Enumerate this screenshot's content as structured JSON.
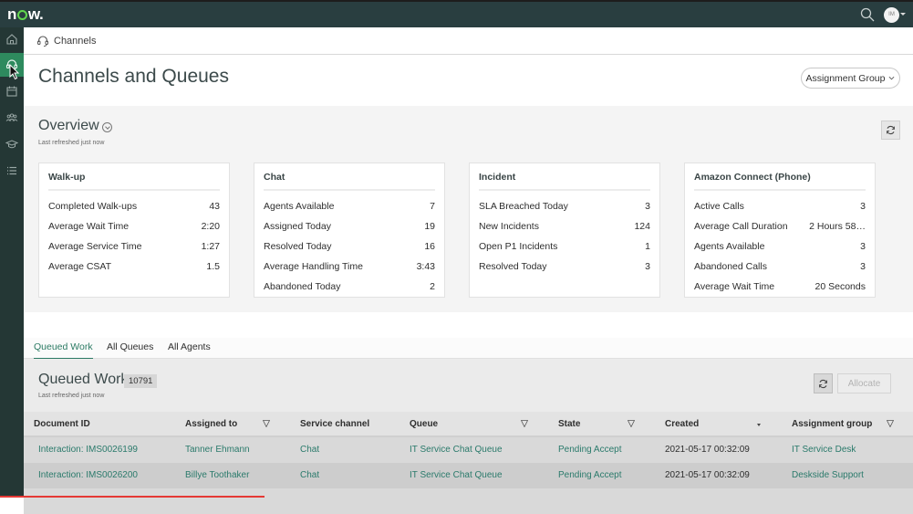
{
  "app": {
    "logo_text": "now",
    "avatar_initials": "IM"
  },
  "sidebar": {
    "items": [
      {
        "icon": "home-icon",
        "active": false
      },
      {
        "icon": "headset-icon",
        "active": true
      },
      {
        "icon": "calendar-icon",
        "active": false
      },
      {
        "icon": "team-icon",
        "active": false
      },
      {
        "icon": "graduation-cap-icon",
        "active": false
      },
      {
        "icon": "list-icon",
        "active": false
      }
    ]
  },
  "breadcrumb": {
    "icon": "headset-icon",
    "label": "Channels"
  },
  "page": {
    "title": "Channels and Queues",
    "assignment_group_label": "Assignment Group"
  },
  "overview": {
    "title": "Overview",
    "last_refreshed": "Last refreshed just now",
    "cards": [
      {
        "title": "Walk-up",
        "rows": [
          {
            "label": "Completed Walk-ups",
            "value": "43"
          },
          {
            "label": "Average Wait Time",
            "value": "2:20"
          },
          {
            "label": "Average Service Time",
            "value": "1:27"
          },
          {
            "label": "Average CSAT",
            "value": "1.5"
          }
        ]
      },
      {
        "title": "Chat",
        "rows": [
          {
            "label": "Agents Available",
            "value": "7"
          },
          {
            "label": "Assigned Today",
            "value": "19"
          },
          {
            "label": "Resolved Today",
            "value": "16"
          },
          {
            "label": "Average Handling Time",
            "value": "3:43"
          },
          {
            "label": "Abandoned Today",
            "value": "2"
          }
        ]
      },
      {
        "title": "Incident",
        "rows": [
          {
            "label": "SLA Breached Today",
            "value": "3"
          },
          {
            "label": "New Incidents",
            "value": "124"
          },
          {
            "label": "Open P1 Incidents",
            "value": "1"
          },
          {
            "label": "Resolved Today",
            "value": "3"
          }
        ]
      },
      {
        "title": "Amazon Connect (Phone)",
        "rows": [
          {
            "label": "Active Calls",
            "value": "3"
          },
          {
            "label": "Average Call Duration",
            "value": "2 Hours 58…"
          },
          {
            "label": "Agents Available",
            "value": "3"
          },
          {
            "label": "Abandoned Calls",
            "value": "3"
          },
          {
            "label": "Average Wait Time",
            "value": "20 Seconds"
          }
        ]
      }
    ]
  },
  "tabs": [
    {
      "label": "Queued Work",
      "active": true
    },
    {
      "label": "All Queues",
      "active": false
    },
    {
      "label": "All Agents",
      "active": false
    }
  ],
  "queued_work": {
    "title": "Queued Work",
    "count": "10791",
    "last_refreshed": "Last refreshed just now",
    "allocate_label": "Allocate",
    "columns": [
      {
        "label": "Document ID",
        "filter": false
      },
      {
        "label": "Assigned to",
        "filter": true
      },
      {
        "label": "Service channel",
        "filter": false
      },
      {
        "label": "Queue",
        "filter": true
      },
      {
        "label": "State",
        "filter": true
      },
      {
        "label": "Created",
        "sort": "desc"
      },
      {
        "label": "Assignment group",
        "filter": true
      }
    ],
    "rows": [
      {
        "document_id": "Interaction: IMS0026199",
        "assigned_to": "Tanner Ehmann",
        "service_channel": "Chat",
        "queue": "IT Service Chat Queue",
        "state": "Pending Accept",
        "created": "2021-05-17 00:32:09",
        "assignment_group": "IT Service Desk"
      },
      {
        "document_id": "Interaction: IMS0026200",
        "assigned_to": "Billye Toothaker",
        "service_channel": "Chat",
        "queue": "IT Service Chat Queue",
        "state": "Pending Accept",
        "created": "2021-05-17 00:32:09",
        "assignment_group": "Deskside Support"
      }
    ]
  },
  "colors": {
    "topbar": "#293e40",
    "sidebar": "#243735",
    "sidebar_active": "#2e8a5e",
    "accent_link": "#2a7a6b",
    "logo_accent": "#62d84e"
  }
}
